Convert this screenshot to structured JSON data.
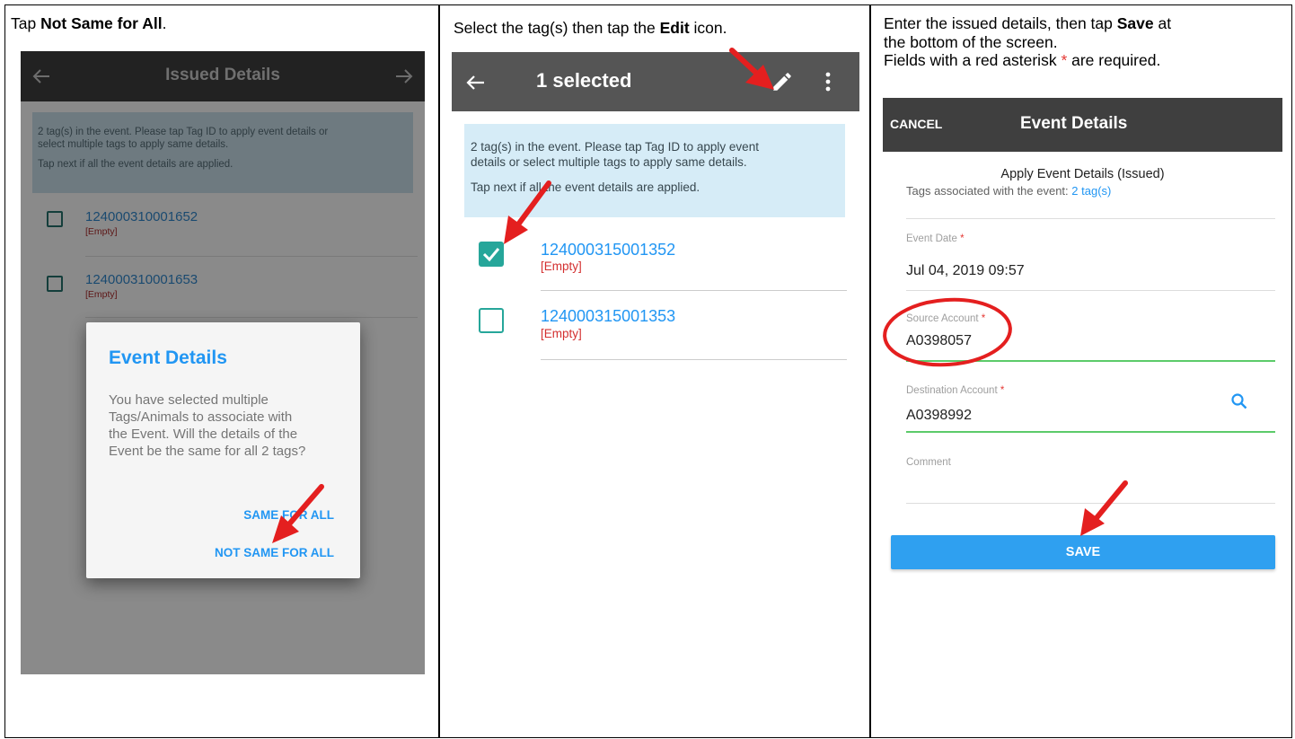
{
  "panel1": {
    "instruction_prefix": "Tap ",
    "instruction_bold": "Not Same for All",
    "instruction_suffix": ".",
    "header_title": "Issued Details",
    "info_line1": "2 tag(s) in the event. Please tap Tag ID to apply event details or",
    "info_line2": "select multiple tags to apply same details.",
    "info_line3": "Tap next if all the event details are applied.",
    "tags": [
      {
        "id": "124000310001652",
        "status": "[Empty]"
      },
      {
        "id": "124000310001653",
        "status": "[Empty]"
      }
    ],
    "dialog": {
      "title": "Event Details",
      "body_lines": [
        "You have selected multiple",
        "Tags/Animals to associate with",
        "the Event. Will the details of the",
        "Event be the same for all 2 tags?"
      ],
      "same_label": "SAME FOR ALL",
      "not_same_label": "NOT SAME FOR ALL"
    }
  },
  "panel2": {
    "instruction_prefix": "Select the tag(s) then tap the ",
    "instruction_bold": "Edit",
    "instruction_suffix": " icon.",
    "header_title": "1 selected",
    "info_line1": "2 tag(s) in the event. Please tap Tag ID to apply event",
    "info_line2": "details or select multiple tags to apply same details.",
    "info_line3": "Tap next if all the event details are applied.",
    "tags": [
      {
        "id": "124000315001352",
        "status": "[Empty]",
        "checked": true
      },
      {
        "id": "124000315001353",
        "status": "[Empty]",
        "checked": false
      }
    ]
  },
  "panel3": {
    "instruction_line1_prefix": "Enter the issued details, then tap ",
    "instruction_line1_bold": "Save",
    "instruction_line1_suffix": " at",
    "instruction_line2": "the bottom of the screen.",
    "instruction_line3_prefix": "Fields with a red asterisk ",
    "instruction_line3_star": "*",
    "instruction_line3_suffix": " are required.",
    "header_cancel": "CANCEL",
    "header_title": "Event Details",
    "form_title": "Apply Event Details (Issued)",
    "tags_assoc_label": "Tags associated with the event: ",
    "tags_assoc_link": "2 tag(s)",
    "fields": [
      {
        "label": "Event Date",
        "value": "Jul 04, 2019 09:57",
        "required": true
      },
      {
        "label": "Source Account",
        "value": "A0398057",
        "required": true
      },
      {
        "label": "Destination Account",
        "value": "A0398992",
        "required": true
      },
      {
        "label": "Comment",
        "value": "",
        "required": false
      }
    ],
    "save_label": "SAVE"
  },
  "colors": {
    "header_dark": "#3f3f3f",
    "accent_blue": "#2196f3",
    "teal": "#26a69a",
    "info_bg": "#d6ecf7",
    "required_red": "#e53935",
    "arrow_red": "#e41f1f"
  }
}
